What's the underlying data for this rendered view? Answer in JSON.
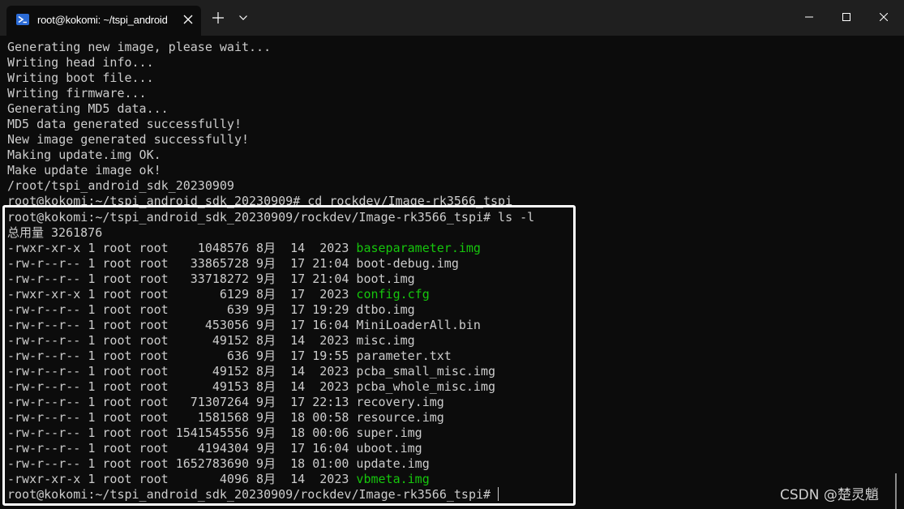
{
  "window": {
    "tab_title": "root@kokomi: ~/tspi_android",
    "tab_icon": "powershell-terminal-icon",
    "controls": [
      "minimize-icon",
      "maximize-icon",
      "close-icon"
    ]
  },
  "terminal": {
    "colors": {
      "background": "#0c0c0c",
      "text": "#cccccc",
      "executable": "#16c60c",
      "titlebar": "#1f1f1f"
    },
    "lines": [
      {
        "text": "Generating new image, please wait..."
      },
      {
        "text": "Writing head info..."
      },
      {
        "text": "Writing boot file..."
      },
      {
        "text": "Writing firmware..."
      },
      {
        "text": "Generating MD5 data..."
      },
      {
        "text": "MD5 data generated successfully!"
      },
      {
        "text": "New image generated successfully!"
      },
      {
        "text": "Making update.img OK."
      },
      {
        "text": "Make update image ok!"
      },
      {
        "text": "/root/tspi_android_sdk_20230909"
      },
      {
        "text": "root@kokomi:~/tspi_android_sdk_20230909# cd rockdev/Image-rk3566_tspi"
      },
      {
        "text": "root@kokomi:~/tspi_android_sdk_20230909/rockdev/Image-rk3566_tspi# ls -l"
      },
      {
        "text": "总用量 3261876"
      },
      {
        "text": "-rwxr-xr-x 1 root root    1048576 8月  14  2023 ",
        "file": "baseparameter.img",
        "exec": true
      },
      {
        "text": "-rw-r--r-- 1 root root   33865728 9月  17 21:04 ",
        "file": "boot-debug.img"
      },
      {
        "text": "-rw-r--r-- 1 root root   33718272 9月  17 21:04 ",
        "file": "boot.img"
      },
      {
        "text": "-rwxr-xr-x 1 root root       6129 8月  17  2023 ",
        "file": "config.cfg",
        "exec": true
      },
      {
        "text": "-rw-r--r-- 1 root root        639 9月  17 19:29 ",
        "file": "dtbo.img"
      },
      {
        "text": "-rw-r--r-- 1 root root     453056 9月  17 16:04 ",
        "file": "MiniLoaderAll.bin"
      },
      {
        "text": "-rw-r--r-- 1 root root      49152 8月  14  2023 ",
        "file": "misc.img"
      },
      {
        "text": "-rw-r--r-- 1 root root        636 9月  17 19:55 ",
        "file": "parameter.txt"
      },
      {
        "text": "-rw-r--r-- 1 root root      49152 8月  14  2023 ",
        "file": "pcba_small_misc.img"
      },
      {
        "text": "-rw-r--r-- 1 root root      49153 8月  14  2023 ",
        "file": "pcba_whole_misc.img"
      },
      {
        "text": "-rw-r--r-- 1 root root   71307264 9月  17 22:13 ",
        "file": "recovery.img"
      },
      {
        "text": "-rw-r--r-- 1 root root    1581568 9月  18 00:58 ",
        "file": "resource.img"
      },
      {
        "text": "-rw-r--r-- 1 root root 1541545556 9月  18 00:06 ",
        "file": "super.img"
      },
      {
        "text": "-rw-r--r-- 1 root root    4194304 9月  17 16:04 ",
        "file": "uboot.img"
      },
      {
        "text": "-rw-r--r-- 1 root root 1652783690 9月  18 01:00 ",
        "file": "update.img"
      },
      {
        "text": "-rwxr-xr-x 1 root root       4096 8月  14  2023 ",
        "file": "vbmeta.img",
        "exec": true
      },
      {
        "text": "root@kokomi:~/tspi_android_sdk_20230909/rockdev/Image-rk3566_tspi# ",
        "cursor": true
      }
    ]
  },
  "watermark": "CSDN @楚灵魈"
}
